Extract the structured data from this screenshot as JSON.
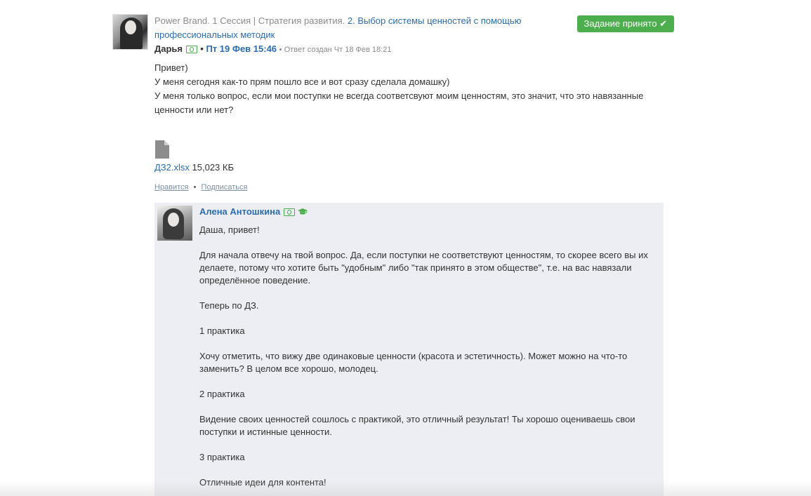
{
  "post": {
    "breadcrumb_prefix": "Power Brand. 1 Сессия | Стратегия развития.",
    "breadcrumb_link": "2. Выбор системы ценностей с помощью профессиональных методик",
    "status_button": "Задание принято ✔",
    "author": "Дарья",
    "date_separator": "•",
    "date": "Пт 19 Фев 15:46",
    "created": "• Ответ создан Чт 18 Фев 18:21",
    "body": [
      "Привет)",
      "У меня сегодня как-то прям пошло все и вот сразу сделала домашку)",
      "У меня только вопрос, если мои поступки не всегда соответсвуют моим ценностям, это значит, что это навязанные ценности или нет?"
    ],
    "file": {
      "name": "ДЗ2.xlsx",
      "size": "15,023 КБ"
    },
    "actions": {
      "like": "Нравится",
      "separator": "•",
      "subscribe": "Подписаться"
    }
  },
  "reply": {
    "author": "Алена Антошкина",
    "body": [
      "Даша, привет!",
      "Для начала отвечу на твой вопрос. Да, если поступки не соответствуют ценностям, то скорее всего вы их делаете, потому что хотите быть \"удобным\" либо \"так принято в этом обществе\", т.е. на вас навязали определённое поведение.",
      "Теперь по ДЗ.",
      "1 практика",
      "Хочу отметить, что вижу две одинаковые ценности (красота и эстетичность). Может можно на что-то заменить? В целом все хорошо, молодец.",
      "2 практика",
      "Видение своих ценностей сошлось с практикой, это отличный результат! Ты хорошо оцениваешь свои поступки и истинные ценности.",
      "3 практика",
      "Отличные идеи для контента!"
    ]
  },
  "icons": {
    "money": "money-icon",
    "graduation": "graduation-cap-icon",
    "file": "file-icon",
    "check": "check-icon"
  },
  "colors": {
    "link": "#2b6cb0",
    "accept": "#4cae4c",
    "reply_bg": "#eceef3",
    "muted": "#8a8a8a"
  }
}
